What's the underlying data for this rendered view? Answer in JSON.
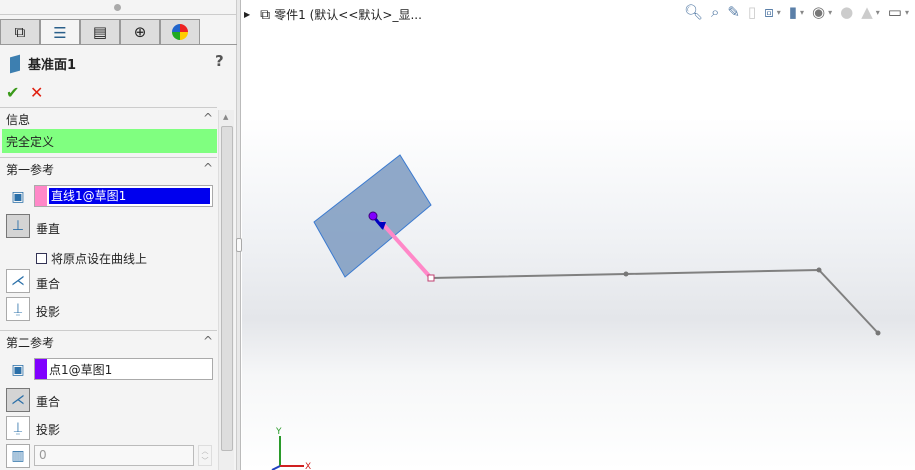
{
  "panel": {
    "tabs": [
      "feature-manager",
      "property-manager",
      "configuration-manager",
      "dimxpert-manager",
      "display-manager"
    ],
    "title": "基准面1",
    "help": "?",
    "ok": "✔",
    "cancel": "✕",
    "info": {
      "header": "信息",
      "status": "完全定义"
    },
    "first_ref": {
      "header": "第一参考",
      "value": "直线1@草图1",
      "swatch": "#ff88c8",
      "options": [
        "垂直",
        "将原点设在曲线上",
        "重合",
        "投影"
      ]
    },
    "second_ref": {
      "header": "第二参考",
      "value": "点1@草图1",
      "swatch": "#8000ff",
      "options": [
        "重合",
        "投影"
      ],
      "number": "0"
    }
  },
  "viewport": {
    "title": "零件1  (默认<<默认>_显...",
    "tools": [
      "zoom-to-fit",
      "zoom-to-area",
      "previous-view",
      "section-view",
      "view-orientation",
      "display-style",
      "hide-show",
      "edit-appearance",
      "apply-scene",
      "view-settings"
    ],
    "triad": {
      "x": "X",
      "y": "Y"
    }
  }
}
